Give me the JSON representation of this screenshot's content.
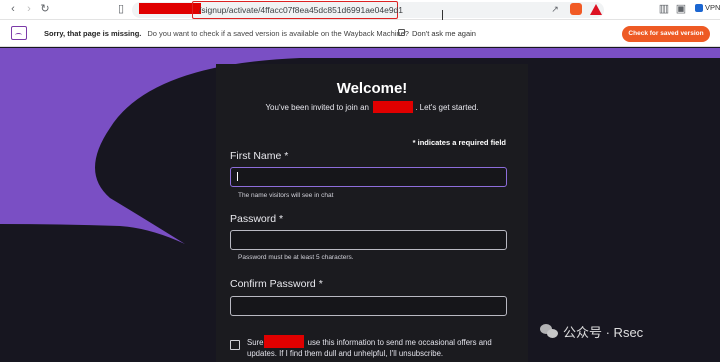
{
  "browser": {
    "url_text": "/signup/activate/4ffacc07f8ea45dc851d6991ae04e9d1",
    "vpn_label": "VPN"
  },
  "infobar": {
    "title": "Sorry, that page is missing.",
    "question": "Do you want to check if a saved version is available on the Wayback Machine?",
    "dont_ask": "Don't ask me again",
    "check_button": "Check for saved version"
  },
  "form": {
    "heading": "Welcome!",
    "invite_prefix": "You've been invited to join an",
    "invite_suffix": ". Let's get started.",
    "required_note": "* indicates a required field",
    "first_name_label": "First Name",
    "first_name_hint": "The name visitors will see in chat",
    "password_label": "Password",
    "password_hint": "Password must be at least 5 characters.",
    "confirm_label": "Confirm Password",
    "required_marker": "*",
    "consent_prefix": "Sure",
    "consent_suffix": "use this information to send me occasional offers and updates. If I find them dull and unhelpful, I'll unsubscribe."
  },
  "watermark": {
    "text": "公众号 · Rsec"
  },
  "colors": {
    "accent_purple": "#7a4fc4",
    "page_bg": "#171620",
    "redaction": "#e00000",
    "infobar_button": "#ee5a24"
  }
}
